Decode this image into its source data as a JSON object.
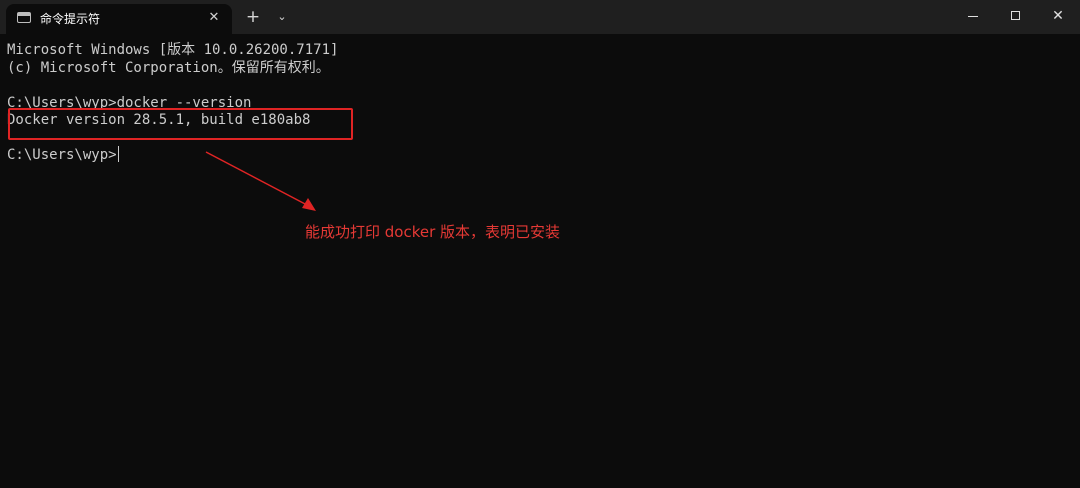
{
  "tab": {
    "title": "命令提示符",
    "close_glyph": "✕",
    "icon": "terminal-icon"
  },
  "tabbar": {
    "new_tab_glyph": "+",
    "dropdown_glyph": "⌄"
  },
  "window_controls": {
    "close_glyph": "✕"
  },
  "terminal": {
    "lines": [
      "Microsoft Windows [版本 10.0.26200.7171]",
      "(c) Microsoft Corporation。保留所有权利。",
      "C:\\Users\\wyp>docker --version",
      "Docker version 28.5.1, build e180ab8",
      "C:\\Users\\wyp>"
    ]
  },
  "annotation": {
    "text": "能成功打印 docker 版本，表明已安装",
    "color": "#e53935"
  },
  "colors": {
    "background": "#0c0c0c",
    "titlebar": "#1f1f1f",
    "text": "#cccccc",
    "highlight": "#e02424"
  }
}
